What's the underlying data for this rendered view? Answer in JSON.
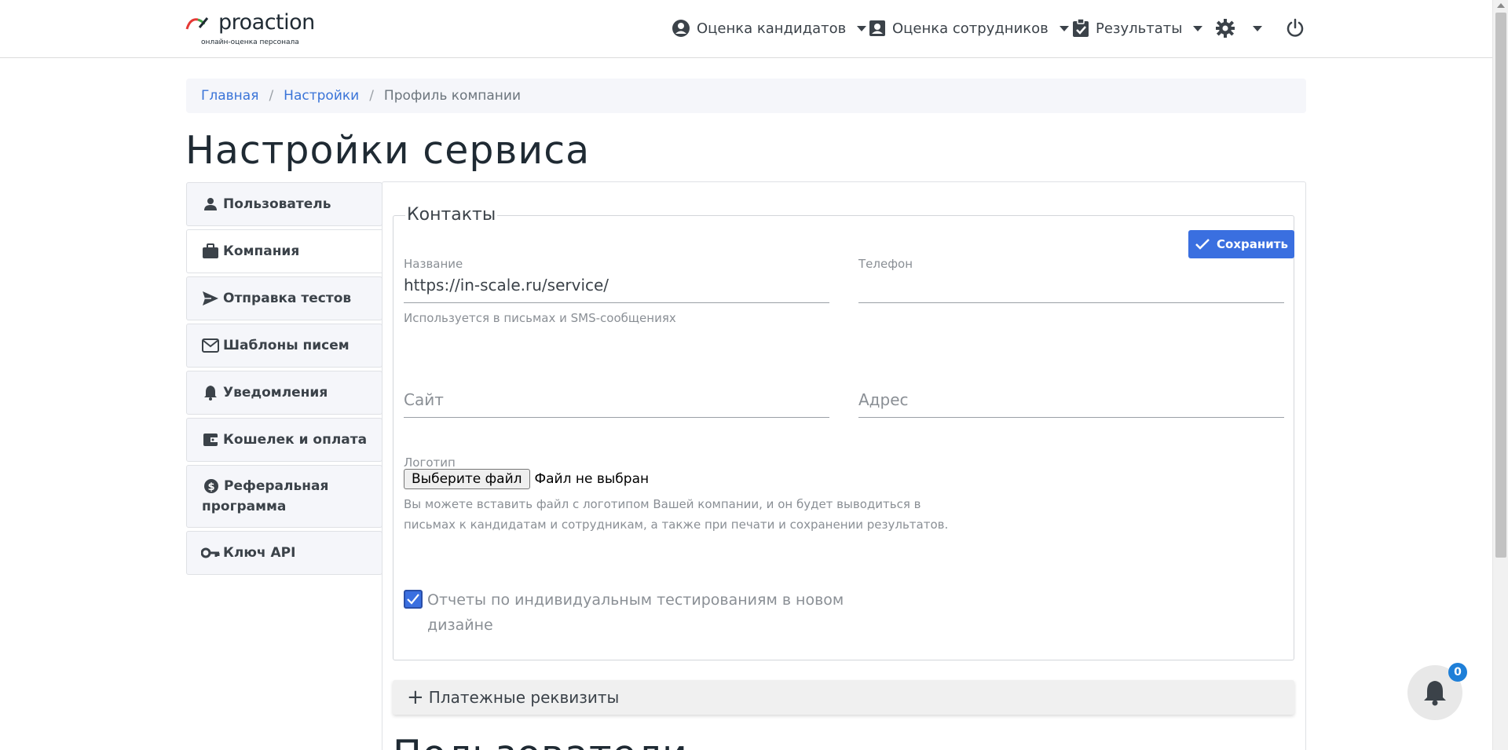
{
  "brand": {
    "name": "proaction",
    "tagline": "онлайн-оценка персонала"
  },
  "nav": {
    "candidates": "Оценка кандидатов",
    "employees": "Оценка сотрудников",
    "results": "Результаты"
  },
  "breadcrumb": {
    "home": "Главная",
    "settings": "Настройки",
    "current": "Профиль компании"
  },
  "page": {
    "title": "Настройки сервиса",
    "next_section_title": "Пользователи"
  },
  "sidebar": {
    "items": [
      {
        "label": "Пользователь",
        "icon": "person-icon"
      },
      {
        "label": "Компания",
        "icon": "briefcase-icon",
        "active": true
      },
      {
        "label": "Отправка тестов",
        "icon": "send-icon"
      },
      {
        "label": "Шаблоны писем",
        "icon": "envelope-icon"
      },
      {
        "label": "Уведомления",
        "icon": "bell-icon"
      },
      {
        "label": "Кошелек и оплата",
        "icon": "wallet-icon"
      },
      {
        "label": "Реферальная программа",
        "icon": "dollar-icon"
      },
      {
        "label": "Ключ API",
        "icon": "key-icon"
      }
    ]
  },
  "contacts": {
    "legend": "Контакты",
    "save_label": "Сохранить",
    "name_label": "Название",
    "name_value": "https://in-scale.ru/service/",
    "name_help": "Используется в письмах и SMS-сообщениях",
    "phone_label": "Телефон",
    "phone_value": "",
    "site_placeholder": "Сайт",
    "address_placeholder": "Адрес",
    "logo_label": "Логотип",
    "file_button": "Выберите файл",
    "file_status": "Файл не выбран",
    "logo_help_1": "Вы можете вставить файл с логотипом Вашей компании, и он будет выводиться в",
    "logo_help_2": "письмах к кандидатам и сотрудникам, а также при печати и сохранении результатов.",
    "checkbox_label": "Отчеты по индивидуальным тестированиям в новом дизайне",
    "checkbox_checked": true
  },
  "accordion": {
    "payment_label": "Платежные реквизиты"
  },
  "notifications": {
    "count": "0"
  },
  "colors": {
    "accent": "#3a6fe0",
    "link": "#3a74d8",
    "badge": "#1e7fd8"
  }
}
